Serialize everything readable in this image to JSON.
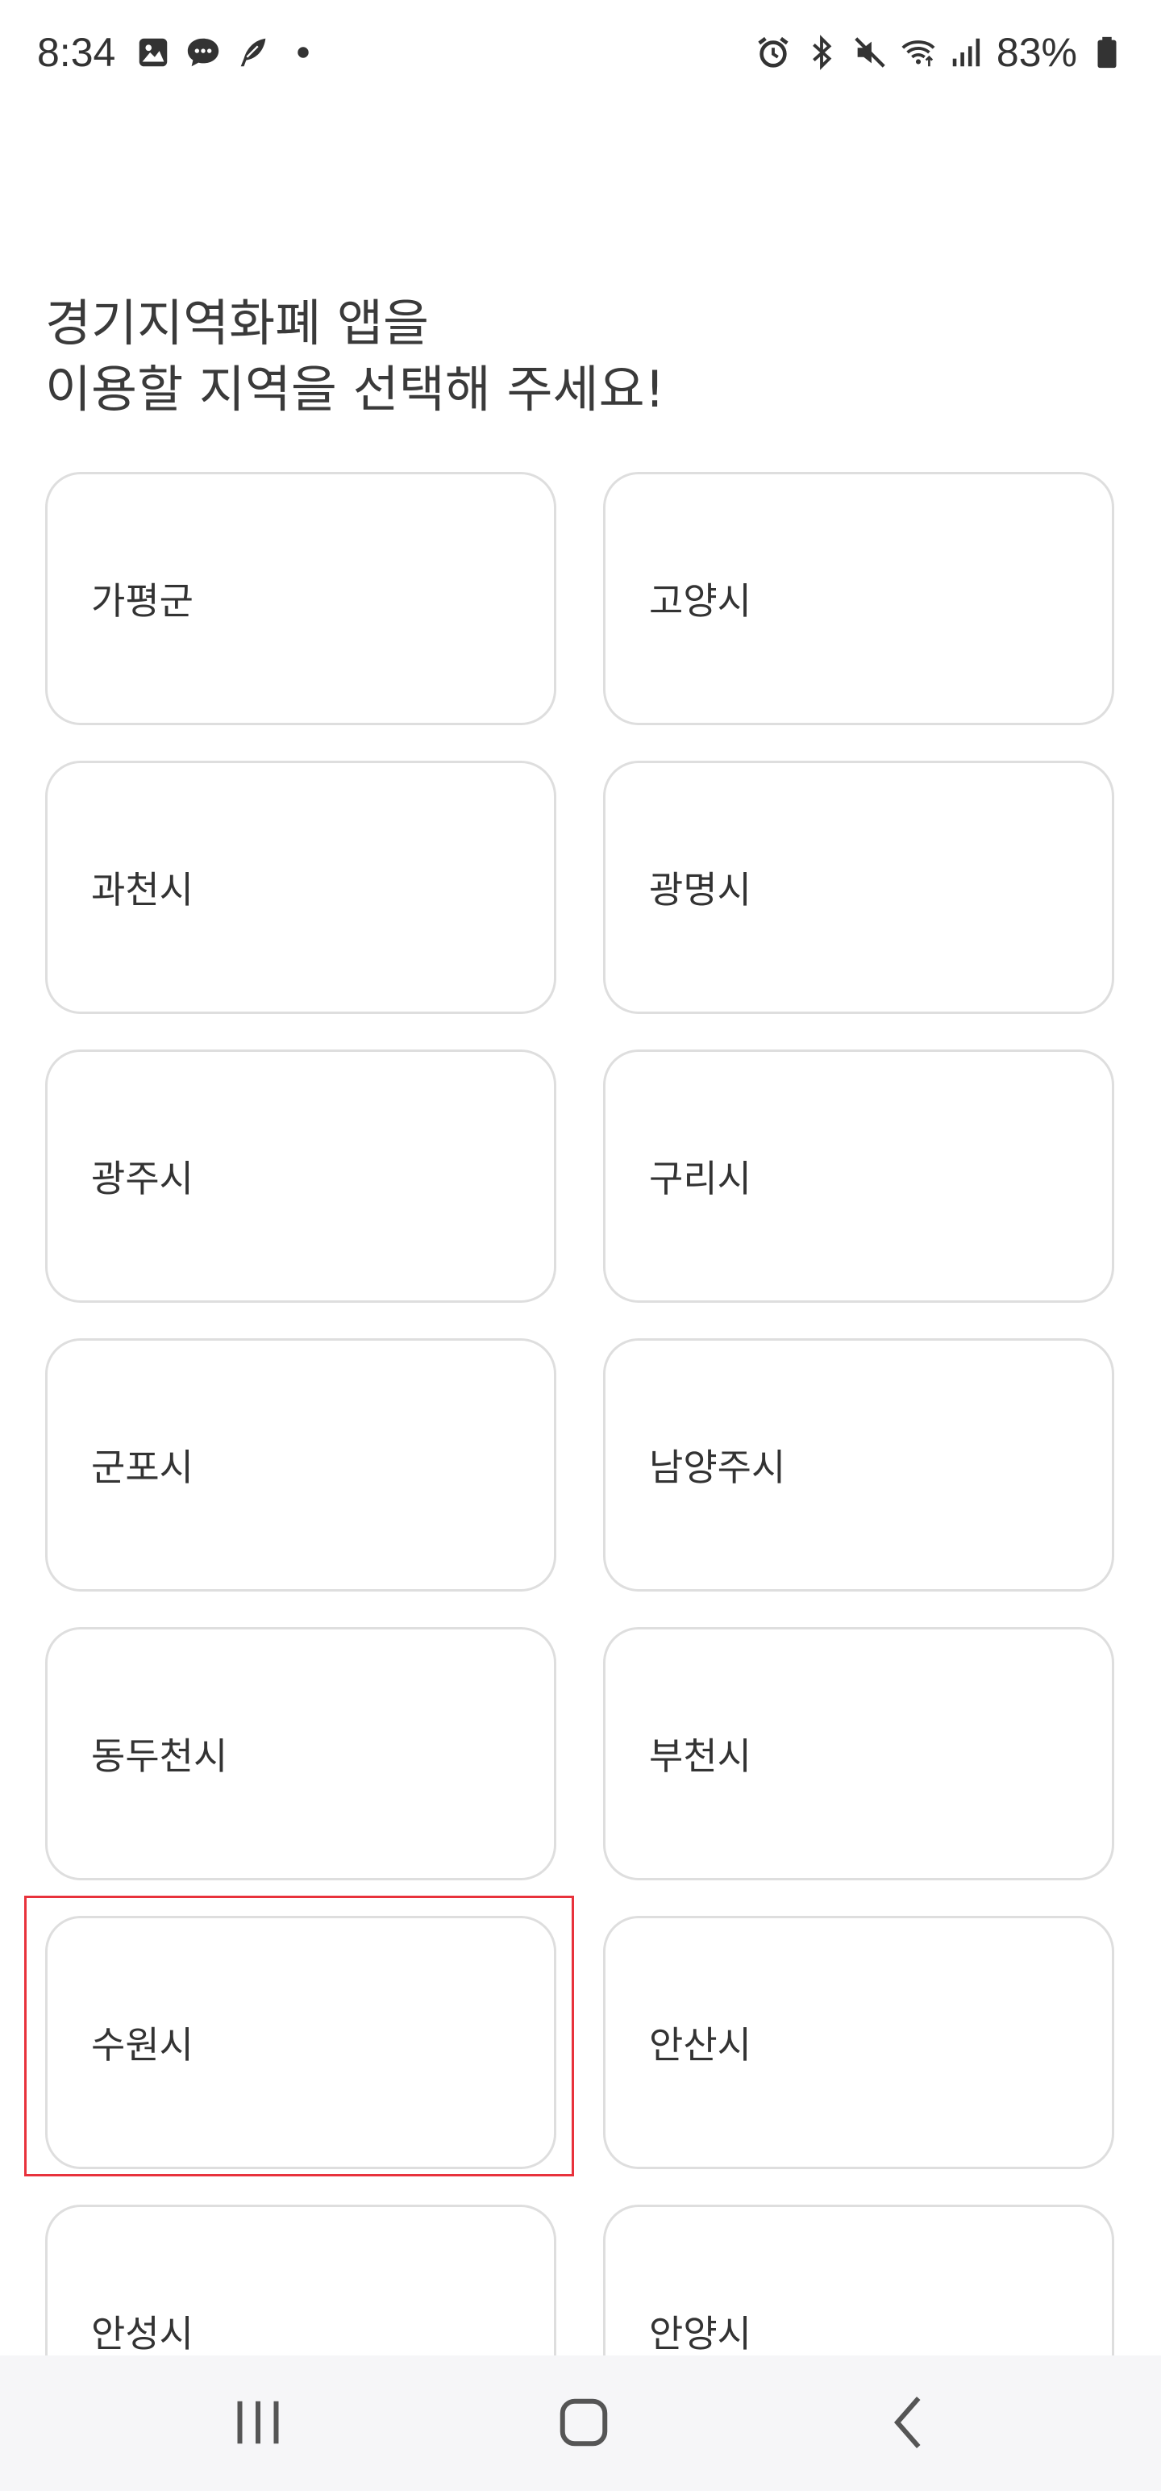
{
  "status_bar": {
    "time": "8:34",
    "battery": "83%",
    "left_icons": [
      "gallery-icon",
      "messages-icon",
      "feather-icon",
      "dot-icon"
    ],
    "right_icons": [
      "alarm-icon",
      "bluetooth-icon",
      "mute-icon",
      "wifi-icon",
      "signal-icon",
      "battery-icon"
    ]
  },
  "header": {
    "title": "경기지역화폐 앱을\n이용할 지역을 선택해 주세요!"
  },
  "regions": [
    "가평군",
    "고양시",
    "과천시",
    "광명시",
    "광주시",
    "구리시",
    "군포시",
    "남양주시",
    "동두천시",
    "부천시",
    "수원시",
    "안산시",
    "안성시",
    "안양시"
  ],
  "highlighted_region": "수원시",
  "colors": {
    "card_border": "#dedede",
    "highlight": "#e8323c",
    "text": "#333333",
    "nav_background": "#f6f6f8"
  },
  "nav": {
    "icons": [
      "recent-apps-icon",
      "home-icon",
      "back-icon"
    ]
  }
}
